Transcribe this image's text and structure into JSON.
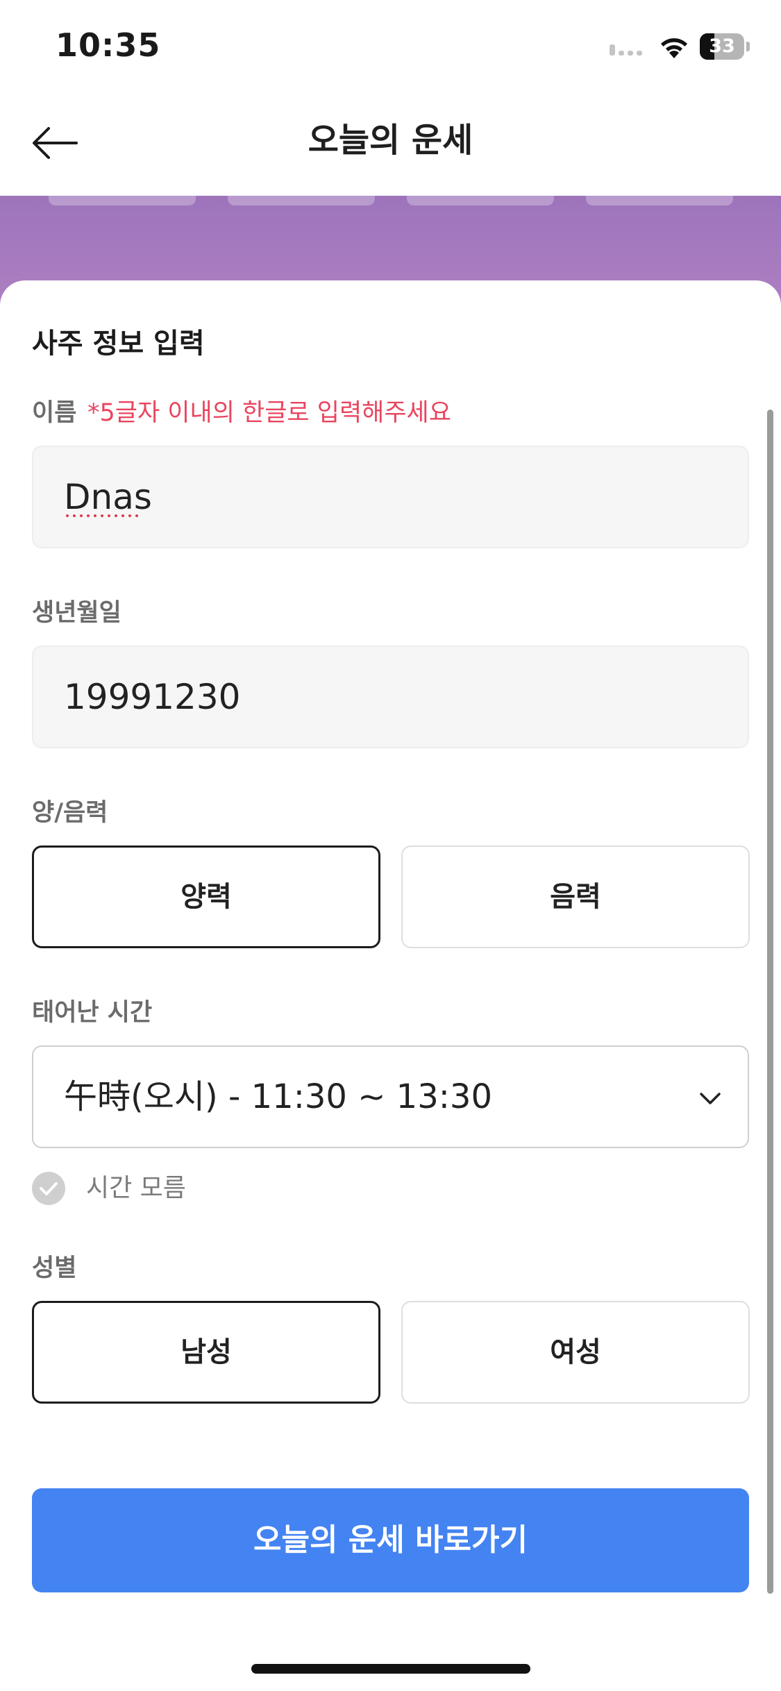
{
  "status_bar": {
    "time": "10:35",
    "battery": "33",
    "battery_level": 0.33,
    "icons": [
      "signal-icon",
      "wifi-icon",
      "battery-icon"
    ]
  },
  "nav": {
    "title": "오늘의 운세",
    "back_icon": "arrow-left-icon"
  },
  "form": {
    "section_title": "사주 정보 입력",
    "name": {
      "label": "이름",
      "hint": "*5글자 이내의 한글로 입력해주세요",
      "value": "Dnas"
    },
    "birth": {
      "label": "생년월일",
      "value": "19991230"
    },
    "calendar": {
      "label": "양/음력",
      "options": [
        "양력",
        "음력"
      ],
      "selected": "양력"
    },
    "birth_time": {
      "label": "태어난 시간",
      "value": "午時(오시) - 11:30 ~ 13:30",
      "unknown_label": "시간 모름",
      "unknown_checked": false
    },
    "gender": {
      "label": "성별",
      "options": [
        "남성",
        "여성"
      ],
      "selected": "남성"
    },
    "submit_label": "오늘의 운세 바로가기"
  },
  "colors": {
    "accent": "#4483f2",
    "hint": "#e9455f",
    "band_top": "#9d74bb",
    "band_bottom": "#ae7fc2"
  }
}
